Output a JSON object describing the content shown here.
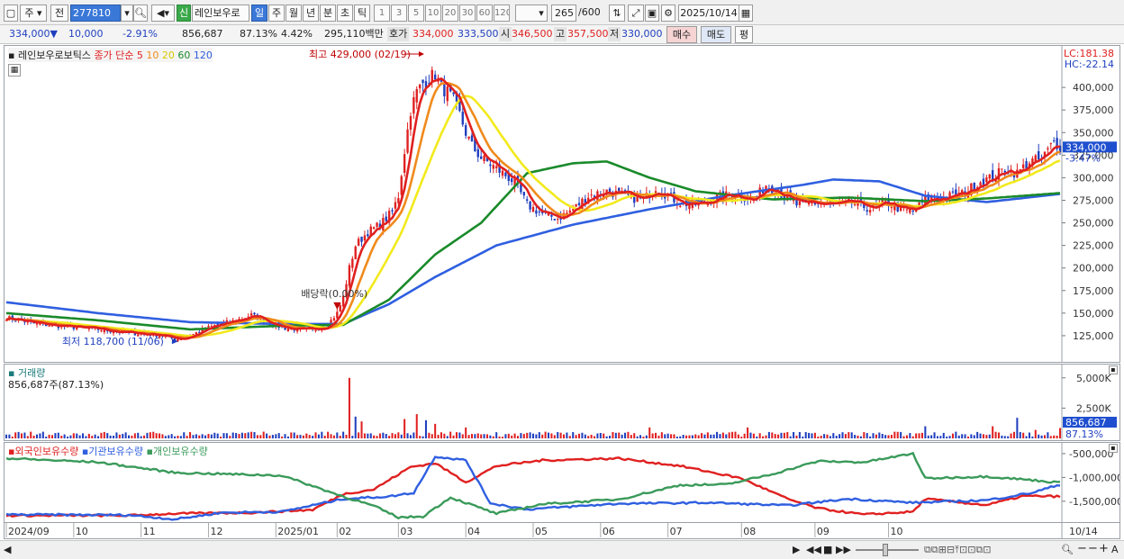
{
  "toolbar": {
    "market_label": "주",
    "prev_label": "전",
    "code": "277810",
    "new_badge": "신",
    "stock_name": "레인보우로",
    "periods": [
      "일",
      "주",
      "월",
      "년",
      "분",
      "초",
      "틱"
    ],
    "active_period": "일",
    "minutes": [
      "1",
      "3",
      "5",
      "10",
      "20",
      "30",
      "60",
      "120"
    ],
    "count": "265",
    "count_max": "/600",
    "date": "2025/10/14",
    "icons": [
      "box-icon",
      "dropdown-icon",
      "search-icon",
      "speaker-icon",
      "chart-tools-icon",
      "draw-icon",
      "save-icon",
      "settings-icon",
      "calendar-icon"
    ]
  },
  "quote": {
    "price": "334,000",
    "direction": "▼",
    "change": "10,000",
    "change_pct": "-2.91%",
    "volume": "856,687",
    "volume_ratio": "87.13%",
    "turnover_pct": "4.42%",
    "amount": "295,110백만",
    "hoga_label": "호가",
    "ask": "334,000",
    "bid": "333,500",
    "open_label": "시",
    "open": "346,500",
    "high_label": "고",
    "high": "357,500",
    "low_label": "저",
    "low": "330,000",
    "buy_label": "매수",
    "sell_label": "매도",
    "flat_label": "평"
  },
  "colors": {
    "up": "#e02020",
    "down": "#1f3fbf",
    "ma5": "#e02020",
    "ma10": "#f08a1c",
    "ma20": "#f2ea1c",
    "ma60": "#1a8a2a",
    "ma120": "#2f5fe0",
    "foreign": "#e02020",
    "institution": "#2f5fe0",
    "individual": "#3a9a5a"
  },
  "chart_data": [
    {
      "type": "candlestick",
      "title": "레인보우로보틱스",
      "legend": {
        "prefix": "종가 단순",
        "periods": [
          "5",
          "10",
          "20",
          "60",
          "120"
        ]
      },
      "lc": "LC:181.38",
      "hc": "HC:-22.14",
      "ylim": [
        100000,
        440000
      ],
      "y_ticks": [
        "400,000",
        "375,000",
        "350,000",
        "325,000",
        "300,000",
        "275,000",
        "250,000",
        "225,000",
        "200,000",
        "175,000",
        "150,000",
        "125,000"
      ],
      "y_tick_values": [
        400000,
        375000,
        350000,
        325000,
        300000,
        275000,
        250000,
        225000,
        200000,
        175000,
        150000,
        125000
      ],
      "current_price": "334,000",
      "current_change": "-3.47%",
      "annotations": {
        "high": "최고 429,000 (02/19)",
        "low": "최저 118,700 (11/06)",
        "dividend": "배당락(0.00%)"
      },
      "x_labels": [
        "2024/09",
        "10",
        "11",
        "12",
        "2025/01",
        "02",
        "03",
        "04",
        "05",
        "06",
        "07",
        "08",
        "09",
        "10"
      ],
      "x_label_end": "10/14",
      "close_path": [
        [
          0,
          145000
        ],
        [
          10,
          138000
        ],
        [
          20,
          135000
        ],
        [
          30,
          132000
        ],
        [
          40,
          128000
        ],
        [
          50,
          126000
        ],
        [
          55,
          121000
        ],
        [
          60,
          125000
        ],
        [
          65,
          133000
        ],
        [
          70,
          138000
        ],
        [
          75,
          142000
        ],
        [
          80,
          148000
        ],
        [
          85,
          140000
        ],
        [
          90,
          134000
        ],
        [
          95,
          132000
        ],
        [
          100,
          131000
        ],
        [
          105,
          138000
        ],
        [
          108,
          150000
        ],
        [
          110,
          168000
        ],
        [
          112,
          200000
        ],
        [
          114,
          225000
        ],
        [
          118,
          240000
        ],
        [
          122,
          248000
        ],
        [
          126,
          262000
        ],
        [
          128,
          280000
        ],
        [
          130,
          330000
        ],
        [
          132,
          375000
        ],
        [
          134,
          395000
        ],
        [
          136,
          405000
        ],
        [
          138,
          410000
        ],
        [
          140,
          415000
        ],
        [
          142,
          400000
        ],
        [
          144,
          395000
        ],
        [
          146,
          385000
        ],
        [
          148,
          370000
        ],
        [
          150,
          350000
        ],
        [
          152,
          335000
        ],
        [
          155,
          322000
        ],
        [
          158,
          315000
        ],
        [
          162,
          305000
        ],
        [
          166,
          295000
        ],
        [
          170,
          270000
        ],
        [
          175,
          260000
        ],
        [
          180,
          255000
        ],
        [
          185,
          265000
        ],
        [
          190,
          280000
        ],
        [
          196,
          285000
        ],
        [
          202,
          280000
        ],
        [
          208,
          275000
        ],
        [
          212,
          290000
        ],
        [
          216,
          280000
        ],
        [
          220,
          272000
        ],
        [
          226,
          270000
        ],
        [
          232,
          278000
        ],
        [
          238,
          282000
        ],
        [
          244,
          275000
        ],
        [
          248,
          292000
        ],
        [
          252,
          285000
        ],
        [
          258,
          270000
        ],
        [
          264,
          272000
        ],
        [
          270,
          270000
        ],
        [
          276,
          272000
        ],
        [
          282,
          266000
        ],
        [
          288,
          272000
        ],
        [
          292,
          265000
        ],
        [
          296,
          262000
        ],
        [
          300,
          275000
        ],
        [
          306,
          278000
        ],
        [
          312,
          282000
        ],
        [
          318,
          296000
        ],
        [
          322,
          300000
        ],
        [
          326,
          310000
        ],
        [
          330,
          305000
        ],
        [
          334,
          318000
        ],
        [
          338,
          320000
        ],
        [
          342,
          340000
        ],
        [
          344,
          334000
        ]
      ],
      "ma_paths": {
        "ma120": [
          [
            0,
            162000
          ],
          [
            30,
            150000
          ],
          [
            60,
            140000
          ],
          [
            90,
            138000
          ],
          [
            110,
            138000
          ],
          [
            125,
            160000
          ],
          [
            140,
            190000
          ],
          [
            160,
            225000
          ],
          [
            185,
            248000
          ],
          [
            210,
            265000
          ],
          [
            235,
            280000
          ],
          [
            260,
            292000
          ],
          [
            270,
            298000
          ],
          [
            285,
            296000
          ],
          [
            300,
            280000
          ],
          [
            320,
            273000
          ],
          [
            344,
            282000
          ]
        ],
        "ma60": [
          [
            0,
            150000
          ],
          [
            30,
            142000
          ],
          [
            60,
            132000
          ],
          [
            90,
            136000
          ],
          [
            110,
            137000
          ],
          [
            125,
            165000
          ],
          [
            140,
            215000
          ],
          [
            155,
            250000
          ],
          [
            170,
            305000
          ],
          [
            185,
            316000
          ],
          [
            196,
            318000
          ],
          [
            210,
            300000
          ],
          [
            225,
            285000
          ],
          [
            250,
            276000
          ],
          [
            275,
            278000
          ],
          [
            300,
            274000
          ],
          [
            320,
            277000
          ],
          [
            344,
            283000
          ]
        ]
      }
    },
    {
      "type": "bar",
      "title": "거래량",
      "subtitle": "856,687주(87.13%)",
      "y_ticks": [
        "5,000K",
        "2,500K"
      ],
      "y_tick_values": [
        5000,
        2500
      ],
      "ylim": [
        0,
        5800
      ],
      "current": "856,687",
      "current_ratio": "87.13%",
      "spikes": [
        [
          112,
          5000
        ],
        [
          114,
          1800
        ],
        [
          116,
          1400
        ],
        [
          130,
          1600
        ],
        [
          134,
          2000
        ],
        [
          137,
          1500
        ],
        [
          140,
          1200
        ],
        [
          150,
          900
        ],
        [
          210,
          900
        ],
        [
          242,
          900
        ],
        [
          300,
          1000
        ],
        [
          322,
          1000
        ],
        [
          330,
          1700
        ],
        [
          336,
          700
        ],
        [
          344,
          856
        ]
      ],
      "base_level": 350
    },
    {
      "type": "line",
      "legend": [
        "외국인보유수량",
        "기관보유수량",
        "개인보유수량"
      ],
      "y_ticks": [
        "-500,000",
        "-1,000,000",
        "-1,500,000"
      ],
      "y_tick_values": [
        -500000,
        -1000000,
        -1500000
      ],
      "ylim": [
        -1900000,
        -350000
      ],
      "series": [
        {
          "name": "외국인보유수량",
          "points": [
            [
              0,
              -1800000
            ],
            [
              40,
              -1800000
            ],
            [
              55,
              -1760000
            ],
            [
              80,
              -1740000
            ],
            [
              100,
              -1680000
            ],
            [
              110,
              -1350000
            ],
            [
              120,
              -1250000
            ],
            [
              132,
              -780000
            ],
            [
              140,
              -700000
            ],
            [
              150,
              -1100000
            ],
            [
              160,
              -760000
            ],
            [
              175,
              -640000
            ],
            [
              200,
              -600000
            ],
            [
              220,
              -760000
            ],
            [
              240,
              -1020000
            ],
            [
              255,
              -1450000
            ],
            [
              265,
              -1650000
            ],
            [
              280,
              -1780000
            ],
            [
              296,
              -1720000
            ],
            [
              300,
              -1450000
            ],
            [
              320,
              -1580000
            ],
            [
              332,
              -1390000
            ],
            [
              344,
              -1400000
            ]
          ]
        },
        {
          "name": "기관보유수량",
          "points": [
            [
              0,
              -1780000
            ],
            [
              40,
              -1790000
            ],
            [
              55,
              -1880000
            ],
            [
              70,
              -1740000
            ],
            [
              90,
              -1720000
            ],
            [
              110,
              -1450000
            ],
            [
              125,
              -1400000
            ],
            [
              133,
              -1320000
            ],
            [
              140,
              -560000
            ],
            [
              150,
              -640000
            ],
            [
              158,
              -1540000
            ],
            [
              170,
              -1670000
            ],
            [
              200,
              -1550000
            ],
            [
              230,
              -1530000
            ],
            [
              255,
              -1590000
            ],
            [
              275,
              -1450000
            ],
            [
              296,
              -1530000
            ],
            [
              320,
              -1480000
            ],
            [
              335,
              -1320000
            ],
            [
              344,
              -1150000
            ]
          ]
        },
        {
          "name": "개인보유수량",
          "points": [
            [
              0,
              -600000
            ],
            [
              30,
              -680000
            ],
            [
              55,
              -900000
            ],
            [
              90,
              -960000
            ],
            [
              110,
              -1400000
            ],
            [
              120,
              -1600000
            ],
            [
              128,
              -1840000
            ],
            [
              136,
              -1820000
            ],
            [
              145,
              -1420000
            ],
            [
              160,
              -1760000
            ],
            [
              175,
              -1560000
            ],
            [
              200,
              -1460000
            ],
            [
              220,
              -1160000
            ],
            [
              235,
              -1150000
            ],
            [
              250,
              -930000
            ],
            [
              265,
              -660000
            ],
            [
              280,
              -680000
            ],
            [
              296,
              -500000
            ],
            [
              300,
              -1020000
            ],
            [
              320,
              -980000
            ],
            [
              332,
              -1040000
            ],
            [
              344,
              -1110000
            ]
          ]
        }
      ]
    }
  ]
}
